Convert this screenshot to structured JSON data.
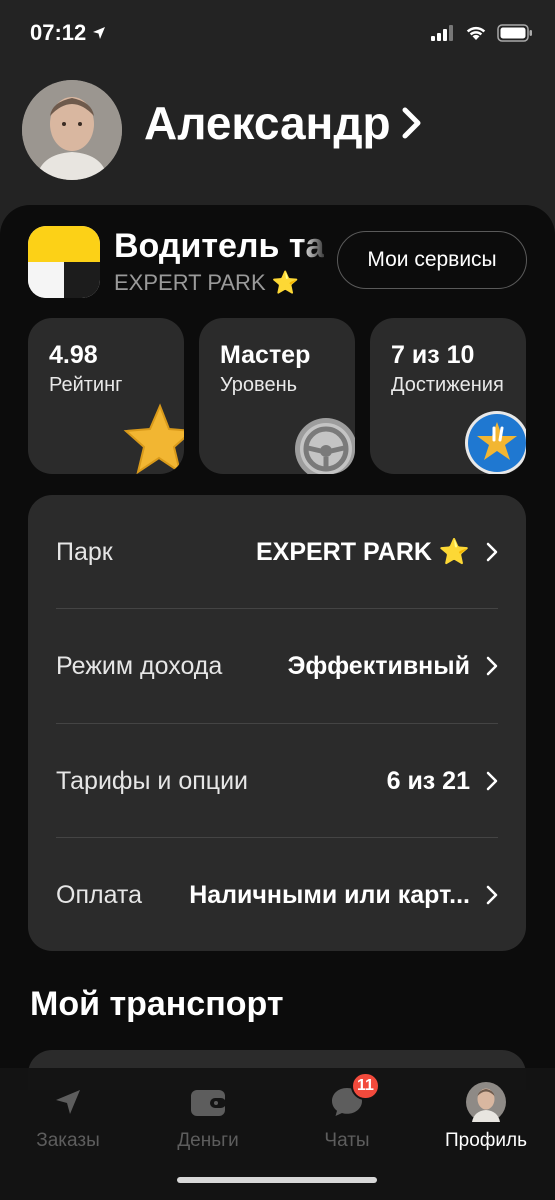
{
  "status_bar": {
    "time": "07:12",
    "icons": [
      "location-arrow-icon",
      "signal-icon",
      "wifi-icon",
      "battery-icon"
    ]
  },
  "profile": {
    "name": "Александр",
    "avatar": "user-photo"
  },
  "driver": {
    "title": "Водитель такси",
    "park_subtitle": "EXPERT PARK ⭐",
    "services_button": "Мои сервисы"
  },
  "stats": [
    {
      "value": "4.98",
      "label": "Рейтинг",
      "icon": "star-icon"
    },
    {
      "value": "Мастер",
      "label": "Уровень",
      "icon": "steering-wheel-icon"
    },
    {
      "value": "7 из 10",
      "label": "Достижения",
      "icon": "achievement-badge-icon"
    }
  ],
  "settings": [
    {
      "label": "Парк",
      "value": "EXPERT PARK ⭐"
    },
    {
      "label": "Режим дохода",
      "value": "Эффективный"
    },
    {
      "label": "Тарифы и опции",
      "value": "6 из 21"
    },
    {
      "label": "Оплата",
      "value": "Наличными или карт..."
    }
  ],
  "transport": {
    "section_title": "Мой транспорт"
  },
  "tabbar": {
    "tabs": [
      {
        "label": "Заказы",
        "icon": "navigation-arrow-icon",
        "active": false
      },
      {
        "label": "Деньги",
        "icon": "wallet-icon",
        "active": false
      },
      {
        "label": "Чаты",
        "icon": "chat-bubble-icon",
        "active": false,
        "badge": "11"
      },
      {
        "label": "Профиль",
        "icon": "avatar",
        "active": true
      }
    ]
  },
  "colors": {
    "background": "#000000",
    "header_bg": "#232323",
    "card_bg": "#2b2b2b",
    "badge": "#f24a3c",
    "star": "#f2b632",
    "brand_yellow": "#fcd117"
  }
}
